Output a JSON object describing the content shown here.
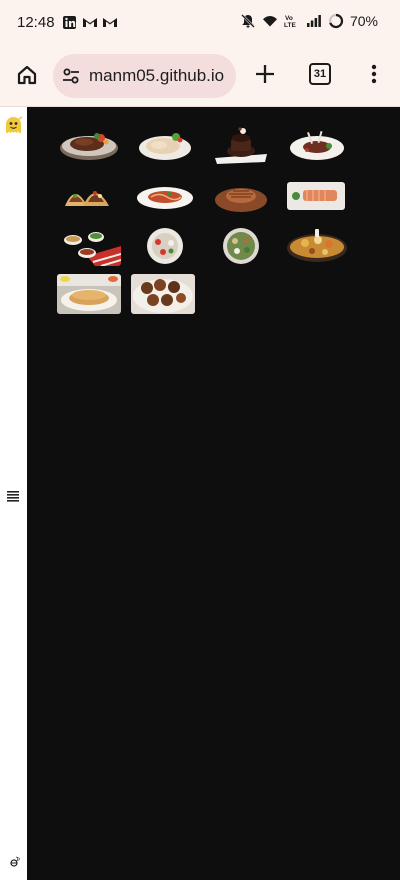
{
  "status_bar": {
    "time": "12:48",
    "battery": "70%"
  },
  "browser": {
    "url": "manm05.github.io",
    "tab_count": "31"
  },
  "gallery": {
    "items": [
      {
        "icon": "steak-platter-icon"
      },
      {
        "icon": "chicken-plate-icon"
      },
      {
        "icon": "chocolate-dessert-icon"
      },
      {
        "icon": "lamb-chops-icon"
      },
      {
        "icon": "tacos-icon"
      },
      {
        "icon": "pasta-plate-icon"
      },
      {
        "icon": "burger-patty-icon"
      },
      {
        "icon": "salmon-fillet-icon"
      },
      {
        "icon": "appetizer-bowls-icon"
      },
      {
        "icon": "caprese-plate-icon"
      },
      {
        "icon": "salad-bowl-icon"
      },
      {
        "icon": "seafood-platter-icon"
      },
      {
        "icon": "pancakes-breakfast-icon"
      },
      {
        "icon": "fried-chicken-icon"
      }
    ]
  },
  "colors": {
    "page_background": "#0e0e0e",
    "chrome_background": "#fdf3ee",
    "omnibox_background": "#f3dedd"
  }
}
